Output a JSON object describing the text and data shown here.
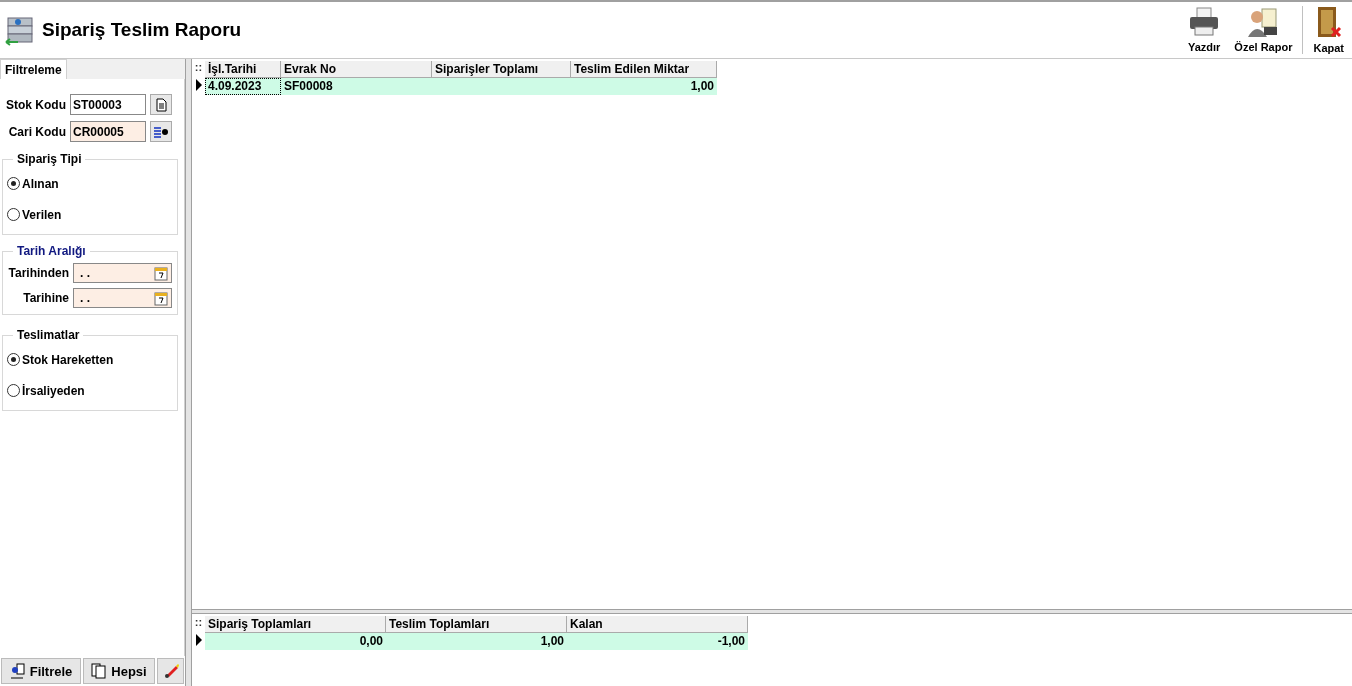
{
  "title": "Sipariş Teslim Raporu",
  "toolbar": [
    {
      "label": "Yazdır",
      "kind": "printer"
    },
    {
      "label": "Özel Rapor",
      "kind": "report"
    },
    {
      "label": "Kapat",
      "kind": "door"
    }
  ],
  "filter_tab": {
    "label": "Filtreleme",
    "selected": true
  },
  "fields": [
    {
      "label": "Stok Kodu",
      "value": "ST00003",
      "kind": "doc",
      "highlighted": false
    },
    {
      "label": "Cari Kodu",
      "value": "CR00005",
      "kind": "list",
      "highlighted": true
    }
  ],
  "order_type": {
    "title": "Sipariş Tipi",
    "options": [
      {
        "label": "Alınan",
        "selected": true
      },
      {
        "label": "Verilen",
        "selected": false
      }
    ]
  },
  "date_range": {
    "title": "Tarih Aralığı",
    "fields": [
      {
        "label": "Tarihinden",
        "value": ". ."
      },
      {
        "label": "Tarihine",
        "value": ". ."
      }
    ]
  },
  "deliveries": {
    "title": "Teslimatlar",
    "options": [
      {
        "label": "Stok Hareketten",
        "selected": true
      },
      {
        "label": "İrsaliyeden",
        "selected": false
      }
    ]
  },
  "buttons": [
    {
      "label": "Filtrele",
      "kind": "filter"
    },
    {
      "label": "Hepsi",
      "kind": "all"
    },
    {
      "kind": "clear"
    }
  ],
  "main_grid": {
    "corner": "::",
    "columns": [
      "İşl.Tarihi",
      "Evrak No",
      "Siparişler Toplamı",
      "Teslim Edilen Miktar"
    ],
    "rows": [
      {
        "selected": true,
        "cells": [
          "4.09.2023",
          "SF00008",
          null,
          "1,00"
        ]
      }
    ]
  },
  "summary_grid": {
    "corner": "::",
    "columns": [
      "Sipariş Toplamları",
      "Teslim Toplamları",
      "Kalan"
    ],
    "rows": [
      {
        "selected": true,
        "cells": [
          "0,00",
          "1,00",
          "-1,00"
        ]
      }
    ]
  }
}
